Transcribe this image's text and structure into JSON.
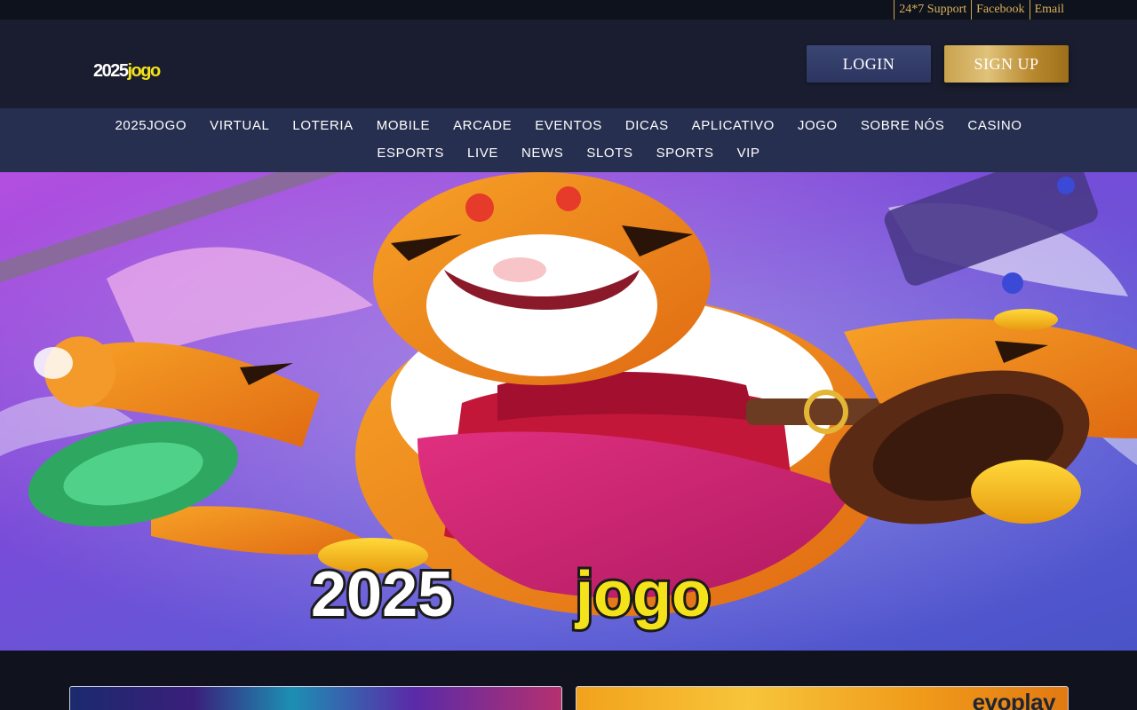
{
  "topbar": {
    "links": [
      "24*7 Support",
      "Facebook",
      "Email"
    ]
  },
  "header": {
    "logo_num": "2025",
    "logo_word": "jogo",
    "login_label": "LOGIN",
    "signup_label": "SIGN UP"
  },
  "nav": {
    "row1": [
      "2025JOGO",
      "VIRTUAL",
      "LOTERIA",
      "MOBILE",
      "ARCADE",
      "EVENTOS",
      "DICAS",
      "APLICATIVO",
      "JOGO",
      "SOBRE NÓS",
      "CASINO"
    ],
    "row2": [
      "ESPORTS",
      "LIVE",
      "NEWS",
      "SLOTS",
      "SPORTS",
      "VIP"
    ]
  },
  "hero": {
    "title_num": "2025",
    "title_word": "jogo"
  },
  "cards": {
    "card2_brand": "evoplay"
  },
  "colors": {
    "gold": "#d9b15a",
    "logo_yellow": "#f4e21a",
    "nav_bg": "#262f4f",
    "header_bg": "#191d2f"
  }
}
